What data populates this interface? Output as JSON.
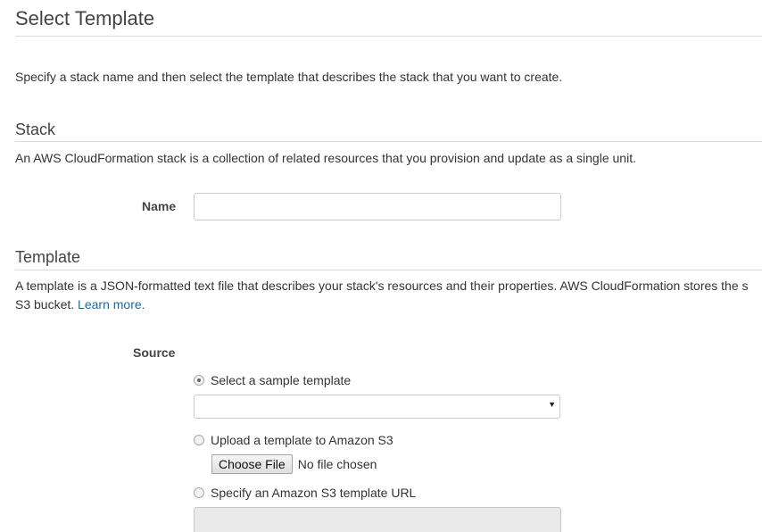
{
  "page": {
    "title": "Select Template",
    "intro": "Specify a stack name and then select the template that describes the stack that you want to create."
  },
  "stack": {
    "heading": "Stack",
    "description": "An AWS CloudFormation stack is a collection of related resources that you provision and update as a single unit.",
    "name_label": "Name",
    "name_value": ""
  },
  "template": {
    "heading": "Template",
    "description_line1": "A template is a JSON-formatted text file that describes your stack's resources and their properties. AWS CloudFormation stores the s",
    "description_line2_prefix": "S3 bucket.",
    "learn_more": "Learn more.",
    "source_label": "Source",
    "options": {
      "sample": {
        "label": "Select a sample template",
        "checked": true
      },
      "upload": {
        "label": "Upload a template to Amazon S3",
        "checked": false
      },
      "url": {
        "label": "Specify an Amazon S3 template URL",
        "checked": false
      }
    },
    "sample_select_value": "",
    "file_button": "Choose File",
    "file_status": "No file chosen",
    "url_value": ""
  }
}
